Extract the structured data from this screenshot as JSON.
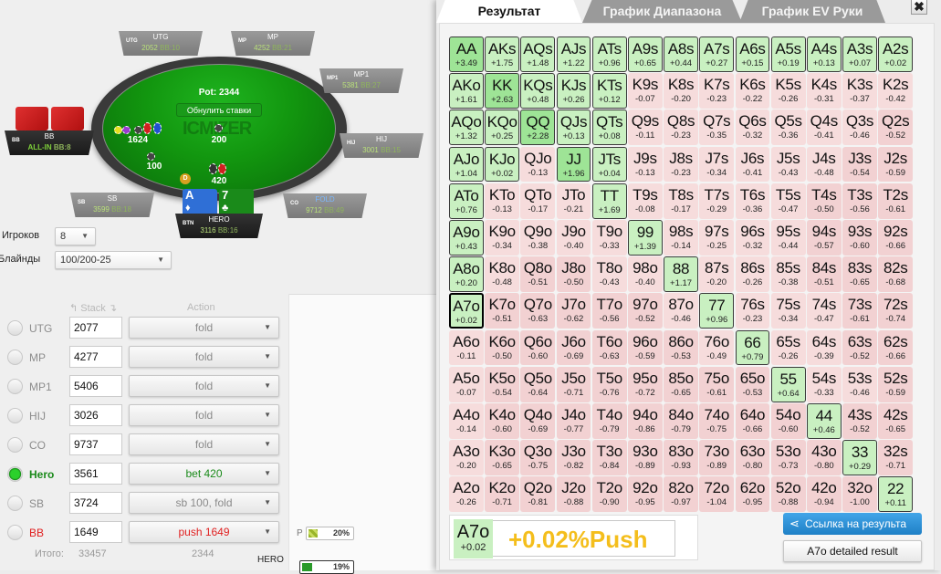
{
  "table": {
    "pot_label": "Pot: 2344",
    "reset_bets": "Обнулить ставки",
    "watermark": "ICMIZER",
    "bets": {
      "bb": "1624",
      "sb": "100",
      "mid": "200",
      "hero": "420"
    },
    "dealer": "D",
    "hero_cards": [
      {
        "rank": "A",
        "suit": "♦",
        "color": "#2f6fd6"
      },
      {
        "rank": "7",
        "suit": "♣",
        "color": "#1a8a1a"
      }
    ],
    "seats": [
      {
        "pos": "UTG",
        "name": "UTG",
        "stack": "2052",
        "bb": "BB:10"
      },
      {
        "pos": "MP",
        "name": "MP",
        "stack": "4252",
        "bb": "BB:21"
      },
      {
        "pos": "MP1",
        "name": "MP1",
        "stack": "5381",
        "bb": "BB:27"
      },
      {
        "pos": "HIJ",
        "name": "HIJ",
        "stack": "3001",
        "bb": "BB:15"
      },
      {
        "pos": "CO",
        "name": "FOLD",
        "stack": "9712",
        "bb": "BB:49"
      },
      {
        "pos": "BTN",
        "name": "HERO",
        "stack": "3116",
        "bb": "BB:16"
      },
      {
        "pos": "SB",
        "name": "SB",
        "stack": "3599",
        "bb": "BB:18"
      },
      {
        "pos": "BB",
        "name": "BB",
        "stack": "ALL-IN",
        "bb": "BB:8"
      }
    ]
  },
  "settings": {
    "players_label": "Игроков",
    "players_value": "8",
    "blinds_label": "Блайнды",
    "blinds_value": "100/200-25"
  },
  "players_table": {
    "stack_header": "Stack",
    "action_header": "Action",
    "rows": [
      {
        "name": "UTG",
        "stack": "2077",
        "action": "fold",
        "selected": false
      },
      {
        "name": "MP",
        "stack": "4277",
        "action": "fold",
        "selected": false
      },
      {
        "name": "MP1",
        "stack": "5406",
        "action": "fold",
        "selected": false
      },
      {
        "name": "HIJ",
        "stack": "3026",
        "action": "fold",
        "selected": false
      },
      {
        "name": "CO",
        "stack": "9737",
        "action": "fold",
        "selected": false
      },
      {
        "name": "Hero",
        "stack": "3561",
        "action": "bet 420",
        "selected": true
      },
      {
        "name": "SB",
        "stack": "3724",
        "action": "sb 100, fold",
        "selected": false
      },
      {
        "name": "BB",
        "stack": "1649",
        "action": "push 1649",
        "selected": false
      }
    ],
    "total_label": "Итого:",
    "total_stack": "33457",
    "total_pot": "2344"
  },
  "ranges": {
    "p_label": "P",
    "p_percent": "20%",
    "p_fraction": 0.2,
    "hero_label": "HERO",
    "hero_percent": "19%",
    "hero_fraction": 0.19
  },
  "tabs": [
    {
      "label": "Результат",
      "active": true
    },
    {
      "label": "График Диапазона",
      "active": false
    },
    {
      "label": "График EV Руки",
      "active": false
    }
  ],
  "close_icon": "✖",
  "grid": [
    [
      [
        "AA",
        "+3.49"
      ],
      [
        "AKs",
        "+1.75"
      ],
      [
        "AQs",
        "+1.48"
      ],
      [
        "AJs",
        "+1.22"
      ],
      [
        "ATs",
        "+0.96"
      ],
      [
        "A9s",
        "+0.65"
      ],
      [
        "A8s",
        "+0.44"
      ],
      [
        "A7s",
        "+0.27"
      ],
      [
        "A6s",
        "+0.15"
      ],
      [
        "A5s",
        "+0.19"
      ],
      [
        "A4s",
        "+0.13"
      ],
      [
        "A3s",
        "+0.07"
      ],
      [
        "A2s",
        "+0.02"
      ]
    ],
    [
      [
        "AKo",
        "+1.61"
      ],
      [
        "KK",
        "+2.63"
      ],
      [
        "KQs",
        "+0.48"
      ],
      [
        "KJs",
        "+0.26"
      ],
      [
        "KTs",
        "+0.12"
      ],
      [
        "K9s",
        "-0.07"
      ],
      [
        "K8s",
        "-0.20"
      ],
      [
        "K7s",
        "-0.23"
      ],
      [
        "K6s",
        "-0.22"
      ],
      [
        "K5s",
        "-0.26"
      ],
      [
        "K4s",
        "-0.31"
      ],
      [
        "K3s",
        "-0.37"
      ],
      [
        "K2s",
        "-0.42"
      ]
    ],
    [
      [
        "AQo",
        "+1.32"
      ],
      [
        "KQo",
        "+0.25"
      ],
      [
        "QQ",
        "+2.28"
      ],
      [
        "QJs",
        "+0.13"
      ],
      [
        "QTs",
        "+0.08"
      ],
      [
        "Q9s",
        "-0.11"
      ],
      [
        "Q8s",
        "-0.23"
      ],
      [
        "Q7s",
        "-0.35"
      ],
      [
        "Q6s",
        "-0.32"
      ],
      [
        "Q5s",
        "-0.36"
      ],
      [
        "Q4s",
        "-0.41"
      ],
      [
        "Q3s",
        "-0.46"
      ],
      [
        "Q2s",
        "-0.52"
      ]
    ],
    [
      [
        "AJo",
        "+1.04"
      ],
      [
        "KJo",
        "+0.02"
      ],
      [
        "QJo",
        "-0.13"
      ],
      [
        "JJ",
        "+1.96"
      ],
      [
        "JTs",
        "+0.04"
      ],
      [
        "J9s",
        "-0.13"
      ],
      [
        "J8s",
        "-0.23"
      ],
      [
        "J7s",
        "-0.34"
      ],
      [
        "J6s",
        "-0.41"
      ],
      [
        "J5s",
        "-0.43"
      ],
      [
        "J4s",
        "-0.48"
      ],
      [
        "J3s",
        "-0.54"
      ],
      [
        "J2s",
        "-0.59"
      ]
    ],
    [
      [
        "ATo",
        "+0.76"
      ],
      [
        "KTo",
        "-0.13"
      ],
      [
        "QTo",
        "-0.17"
      ],
      [
        "JTo",
        "-0.21"
      ],
      [
        "TT",
        "+1.69"
      ],
      [
        "T9s",
        "-0.08"
      ],
      [
        "T8s",
        "-0.17"
      ],
      [
        "T7s",
        "-0.29"
      ],
      [
        "T6s",
        "-0.36"
      ],
      [
        "T5s",
        "-0.47"
      ],
      [
        "T4s",
        "-0.50"
      ],
      [
        "T3s",
        "-0.56"
      ],
      [
        "T2s",
        "-0.61"
      ]
    ],
    [
      [
        "A9o",
        "+0.43"
      ],
      [
        "K9o",
        "-0.34"
      ],
      [
        "Q9o",
        "-0.38"
      ],
      [
        "J9o",
        "-0.40"
      ],
      [
        "T9o",
        "-0.33"
      ],
      [
        "99",
        "+1.39"
      ],
      [
        "98s",
        "-0.14"
      ],
      [
        "97s",
        "-0.25"
      ],
      [
        "96s",
        "-0.32"
      ],
      [
        "95s",
        "-0.44"
      ],
      [
        "94s",
        "-0.57"
      ],
      [
        "93s",
        "-0.60"
      ],
      [
        "92s",
        "-0.66"
      ]
    ],
    [
      [
        "A8o",
        "+0.20"
      ],
      [
        "K8o",
        "-0.48"
      ],
      [
        "Q8o",
        "-0.51"
      ],
      [
        "J8o",
        "-0.50"
      ],
      [
        "T8o",
        "-0.43"
      ],
      [
        "98o",
        "-0.40"
      ],
      [
        "88",
        "+1.17"
      ],
      [
        "87s",
        "-0.20"
      ],
      [
        "86s",
        "-0.26"
      ],
      [
        "85s",
        "-0.38"
      ],
      [
        "84s",
        "-0.51"
      ],
      [
        "83s",
        "-0.65"
      ],
      [
        "82s",
        "-0.68"
      ]
    ],
    [
      [
        "A7o",
        "+0.02"
      ],
      [
        "K7o",
        "-0.51"
      ],
      [
        "Q7o",
        "-0.63"
      ],
      [
        "J7o",
        "-0.62"
      ],
      [
        "T7o",
        "-0.56"
      ],
      [
        "97o",
        "-0.52"
      ],
      [
        "87o",
        "-0.46"
      ],
      [
        "77",
        "+0.96"
      ],
      [
        "76s",
        "-0.23"
      ],
      [
        "75s",
        "-0.34"
      ],
      [
        "74s",
        "-0.47"
      ],
      [
        "73s",
        "-0.61"
      ],
      [
        "72s",
        "-0.74"
      ]
    ],
    [
      [
        "A6o",
        "-0.11"
      ],
      [
        "K6o",
        "-0.50"
      ],
      [
        "Q6o",
        "-0.60"
      ],
      [
        "J6o",
        "-0.69"
      ],
      [
        "T6o",
        "-0.63"
      ],
      [
        "96o",
        "-0.59"
      ],
      [
        "86o",
        "-0.53"
      ],
      [
        "76o",
        "-0.49"
      ],
      [
        "66",
        "+0.79"
      ],
      [
        "65s",
        "-0.26"
      ],
      [
        "64s",
        "-0.39"
      ],
      [
        "63s",
        "-0.52"
      ],
      [
        "62s",
        "-0.66"
      ]
    ],
    [
      [
        "A5o",
        "-0.07"
      ],
      [
        "K5o",
        "-0.54"
      ],
      [
        "Q5o",
        "-0.64"
      ],
      [
        "J5o",
        "-0.71"
      ],
      [
        "T5o",
        "-0.76"
      ],
      [
        "95o",
        "-0.72"
      ],
      [
        "85o",
        "-0.65"
      ],
      [
        "75o",
        "-0.61"
      ],
      [
        "65o",
        "-0.53"
      ],
      [
        "55",
        "+0.64"
      ],
      [
        "54s",
        "-0.33"
      ],
      [
        "53s",
        "-0.46"
      ],
      [
        "52s",
        "-0.59"
      ]
    ],
    [
      [
        "A4o",
        "-0.14"
      ],
      [
        "K4o",
        "-0.60"
      ],
      [
        "Q4o",
        "-0.69"
      ],
      [
        "J4o",
        "-0.77"
      ],
      [
        "T4o",
        "-0.79"
      ],
      [
        "94o",
        "-0.86"
      ],
      [
        "84o",
        "-0.79"
      ],
      [
        "74o",
        "-0.75"
      ],
      [
        "64o",
        "-0.66"
      ],
      [
        "54o",
        "-0.60"
      ],
      [
        "44",
        "+0.46"
      ],
      [
        "43s",
        "-0.52"
      ],
      [
        "42s",
        "-0.65"
      ]
    ],
    [
      [
        "A3o",
        "-0.20"
      ],
      [
        "K3o",
        "-0.65"
      ],
      [
        "Q3o",
        "-0.75"
      ],
      [
        "J3o",
        "-0.82"
      ],
      [
        "T3o",
        "-0.84"
      ],
      [
        "93o",
        "-0.89"
      ],
      [
        "83o",
        "-0.93"
      ],
      [
        "73o",
        "-0.89"
      ],
      [
        "63o",
        "-0.80"
      ],
      [
        "53o",
        "-0.73"
      ],
      [
        "43o",
        "-0.80"
      ],
      [
        "33",
        "+0.29"
      ],
      [
        "32s",
        "-0.71"
      ]
    ],
    [
      [
        "A2o",
        "-0.26"
      ],
      [
        "K2o",
        "-0.71"
      ],
      [
        "Q2o",
        "-0.81"
      ],
      [
        "J2o",
        "-0.88"
      ],
      [
        "T2o",
        "-0.90"
      ],
      [
        "92o",
        "-0.95"
      ],
      [
        "82o",
        "-0.97"
      ],
      [
        "72o",
        "-1.04"
      ],
      [
        "62o",
        "-0.95"
      ],
      [
        "52o",
        "-0.88"
      ],
      [
        "42o",
        "-0.94"
      ],
      [
        "32o",
        "-1.00"
      ],
      [
        "22",
        "+0.11"
      ]
    ]
  ],
  "selected_hand": "A7o",
  "summary": {
    "hand": "A7o",
    "ev": "+0.02",
    "result": "+0.02%Push"
  },
  "buttons": {
    "share": "Ссылка на результа",
    "detailed": "A7o detailed result"
  },
  "colors": {
    "positive": "#c9f0c1",
    "negative": "#f6dcdc",
    "accent_blue": "#2b8fd8",
    "result_yellow": "#f4be1c"
  }
}
